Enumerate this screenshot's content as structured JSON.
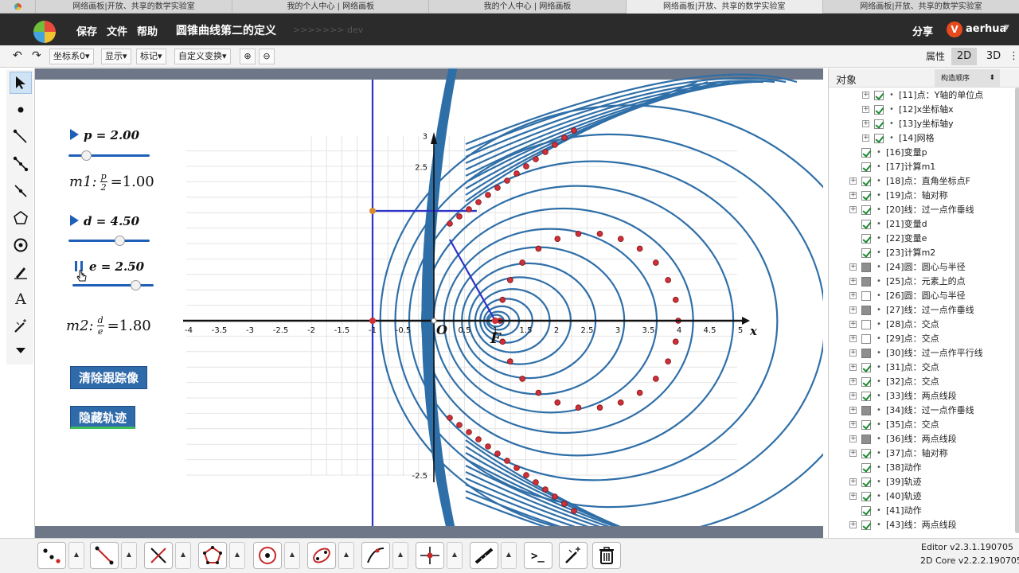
{
  "browser_tabs": [
    "网络画板|开放、共享的数学实验室",
    "我的个人中心 | 网络画板",
    "我的个人中心 | 网络画板",
    "网络画板|开放、共享的数学实验室",
    "网络画板|开放、共享的数学实验室"
  ],
  "header": {
    "menu": [
      "保存",
      "文件",
      "帮助"
    ],
    "title": "圆锥曲线第二的定义",
    "subtitle": ">>>>>>> dev",
    "share": "分享",
    "user_badge": "V",
    "username": "aerhua",
    "caret": "▼"
  },
  "toolbar": {
    "undo": "↶",
    "redo": "↷",
    "coord": "坐标系0▾",
    "display": "显示▾",
    "mark": "标记▾",
    "transform": "自定义变换▾",
    "zoom_in": "⊕",
    "zoom_out": "⊖",
    "properties": "属性",
    "view_2d": "2D",
    "view_3d": "3D",
    "more": "⋮"
  },
  "canvas": {
    "p_label": "p = 2.00",
    "p_value": 0.18,
    "m1_label": "m1:",
    "m1_frac_num": "p",
    "m1_frac_den": "2",
    "m1_value": "=1.00",
    "d_label": "d = 4.50",
    "d_value": 0.65,
    "e_label": "e = 2.50",
    "e_value": 0.82,
    "m2_label": "m2:",
    "m2_frac_num": "d",
    "m2_frac_den": "e",
    "m2_value": "=1.80",
    "btn_clear": "清除跟踪像",
    "btn_hide": "隐藏轨迹",
    "point_o": "O",
    "point_f": "F",
    "axis_x_label": "x",
    "x_ticks": [
      "-4",
      "-3.5",
      "-3",
      "-2.5",
      "-2",
      "-1.5",
      "-1",
      "-0.5",
      "0.5",
      "1",
      "1.5",
      "2",
      "2.5",
      "3",
      "3.5",
      "4",
      "4.5",
      "5"
    ],
    "y_ticks": [
      "3",
      "2.5",
      "-2.5"
    ]
  },
  "panel": {
    "title": "对象",
    "order": "构造顺序",
    "order_arrow": "⬍",
    "items": [
      {
        "label": "[11]点：Y轴的单位点",
        "check": "on",
        "exp": true,
        "indent": 1
      },
      {
        "label": "[12]x坐标轴x",
        "check": "on",
        "exp": true,
        "indent": 1
      },
      {
        "label": "[13]y坐标轴y",
        "check": "on",
        "exp": true,
        "indent": 1
      },
      {
        "label": "[14]网格",
        "check": "on",
        "exp": true,
        "indent": 1
      },
      {
        "label": "[16]变量p",
        "check": "on",
        "exp": false,
        "indent": 0
      },
      {
        "label": "[17]计算m1",
        "check": "on",
        "exp": false,
        "indent": 0
      },
      {
        "label": "[18]点：直角坐标点F",
        "check": "on",
        "exp": true,
        "indent": 0
      },
      {
        "label": "[19]点：轴对称",
        "check": "on",
        "exp": true,
        "indent": 0
      },
      {
        "label": "[20]线：过一点作垂线",
        "check": "on",
        "exp": true,
        "indent": 0
      },
      {
        "label": "[21]变量d",
        "check": "on",
        "exp": false,
        "indent": 0
      },
      {
        "label": "[22]变量e",
        "check": "on",
        "exp": false,
        "indent": 0
      },
      {
        "label": "[23]计算m2",
        "check": "on",
        "exp": false,
        "indent": 0
      },
      {
        "label": "[24]圆：圆心与半径",
        "check": "grey",
        "exp": true,
        "indent": 0
      },
      {
        "label": "[25]点：元素上的点",
        "check": "grey",
        "exp": true,
        "indent": 0
      },
      {
        "label": "[26]圆：圆心与半径",
        "check": "off",
        "exp": true,
        "indent": 0
      },
      {
        "label": "[27]线：过一点作垂线",
        "check": "grey",
        "exp": true,
        "indent": 0
      },
      {
        "label": "[28]点：交点",
        "check": "off",
        "exp": true,
        "indent": 0
      },
      {
        "label": "[29]点：交点",
        "check": "off",
        "exp": true,
        "indent": 0
      },
      {
        "label": "[30]线：过一点作平行线",
        "check": "grey",
        "exp": true,
        "indent": 0
      },
      {
        "label": "[31]点：交点",
        "check": "on",
        "exp": true,
        "indent": 0
      },
      {
        "label": "[32]点：交点",
        "check": "on",
        "exp": true,
        "indent": 0
      },
      {
        "label": "[33]线：两点线段",
        "check": "on",
        "exp": true,
        "indent": 0
      },
      {
        "label": "[34]线：过一点作垂线",
        "check": "grey",
        "exp": true,
        "indent": 0
      },
      {
        "label": "[35]点：交点",
        "check": "on",
        "exp": true,
        "indent": 0
      },
      {
        "label": "[36]线：两点线段",
        "check": "grey",
        "exp": true,
        "indent": 0
      },
      {
        "label": "[37]点：轴对称",
        "check": "on",
        "exp": true,
        "indent": 0
      },
      {
        "label": "[38]动作",
        "check": "on",
        "exp": false,
        "indent": 0
      },
      {
        "label": "[39]轨迹",
        "check": "on",
        "exp": true,
        "indent": 0
      },
      {
        "label": "[40]轨迹",
        "check": "on",
        "exp": true,
        "indent": 0
      },
      {
        "label": "[41]动作",
        "check": "on",
        "exp": false,
        "indent": 0
      },
      {
        "label": "[43]线：两点线段",
        "check": "on",
        "exp": true,
        "indent": 0
      }
    ]
  },
  "footer": {
    "editor_version": "Editor v2.3.1.190705",
    "core_version": "2D Core v2.2.2.190705"
  },
  "colors": {
    "curve": "#2f6fa8",
    "point": "#d0303a",
    "axis_line": "#2b33c8",
    "button": "#2f6aaa"
  }
}
